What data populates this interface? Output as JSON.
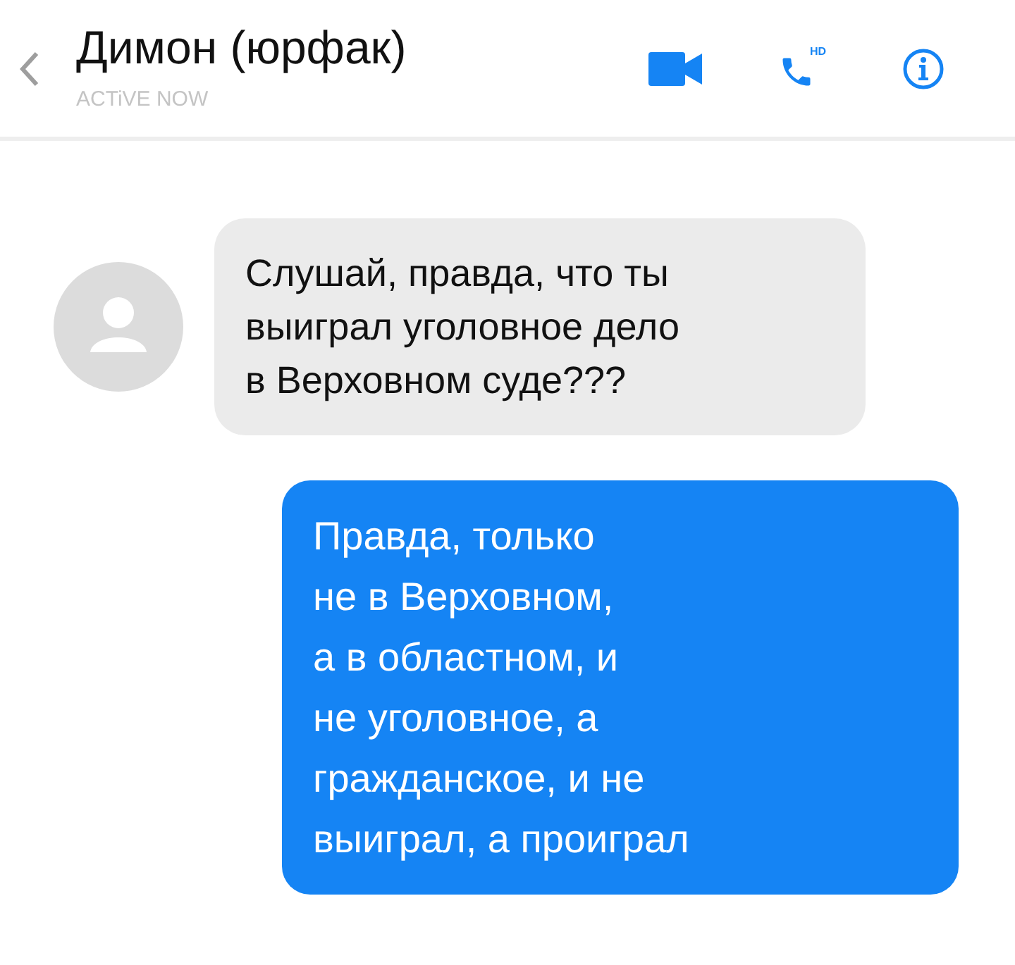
{
  "header": {
    "title": "Димон (юрфак)",
    "status": "ACTiVE NOW",
    "call_badge": "HD"
  },
  "messages": [
    {
      "kind": "incoming",
      "text": "Слушай, правда, что ты\nвыиграл уголовное дело\nв Верховном суде???"
    },
    {
      "kind": "outgoing",
      "text": "Правда, только\nне в Верховном,\nа в областном, и\nне уголовное, а\nгражданское, и не\nвыиграл, а проиграл"
    }
  ]
}
